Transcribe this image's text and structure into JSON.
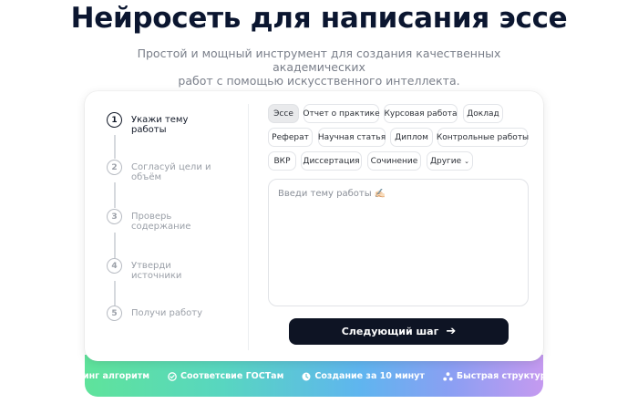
{
  "hero": {
    "title": "Нейросеть для написания эссе",
    "subtitle_line1": "Простой и мощный инструмент для создания качественных академических",
    "subtitle_line2": "работ с помощью искусственного интеллекта."
  },
  "steps": [
    {
      "num": "1",
      "label": "Укажи тему работы",
      "active": true
    },
    {
      "num": "2",
      "label": "Согласуй цели и объём",
      "active": false
    },
    {
      "num": "3",
      "label": "Проверь содержание",
      "active": false
    },
    {
      "num": "4",
      "label": "Утверди источники",
      "active": false
    },
    {
      "num": "5",
      "label": "Получи работу",
      "active": false
    }
  ],
  "work_types": {
    "selected": "Эссе",
    "items": [
      "Эссе",
      "Отчет о практике",
      "Курсовая работа",
      "Доклад",
      "Реферат",
      "Научная статья",
      "Диплом",
      "Контрольные работы",
      "ВКР",
      "Диссертация",
      "Сочинение",
      "Другие"
    ]
  },
  "topic": {
    "placeholder": "Введи тему работы ✍🏻",
    "value": ""
  },
  "next_button": {
    "label": "Следующий шаг",
    "icon": "arrow-right-icon"
  },
  "features": [
    {
      "label": "ктинг алгоритм",
      "icon": ""
    },
    {
      "label": "Соответсвие ГОСТам",
      "icon": "check-circle-icon"
    },
    {
      "label": "Создание за 10 минут",
      "icon": "clock-icon"
    },
    {
      "label": "Быстрая структура",
      "icon": "structure-icon"
    }
  ],
  "colors": {
    "primary_dark": "#0e1424",
    "gradient": [
      "#5fe39b",
      "#58d6c0",
      "#5fb5ef",
      "#8b9ff3",
      "#c59af0"
    ]
  }
}
